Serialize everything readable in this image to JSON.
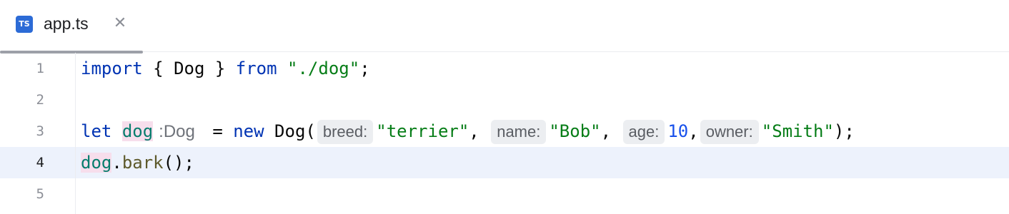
{
  "tab": {
    "icon_text": "TS",
    "file_name": "app.ts",
    "close_glyph": "✕"
  },
  "gutter": {
    "line_numbers": [
      "1",
      "2",
      "3",
      "4",
      "5"
    ],
    "current_line": 4
  },
  "code": {
    "line1": {
      "kw_import": "import",
      "brace_open": " { ",
      "ident": "Dog",
      "brace_close": " } ",
      "kw_from": "from",
      "space": " ",
      "module": "\"./dog\"",
      "semi": ";"
    },
    "line3": {
      "kw_let": "let",
      "space1": " ",
      "var": "dog",
      "type_hint": ":Dog",
      "eq": " = ",
      "kw_new": "new",
      "space2": " ",
      "ctor": "Dog",
      "paren_open": "(",
      "hint_breed": "breed:",
      "val_breed": "\"terrier\"",
      "comma1": ", ",
      "hint_name": "name:",
      "val_name": "\"Bob\"",
      "comma2": ", ",
      "hint_age": "age:",
      "val_age": "10",
      "comma3": ",",
      "hint_owner": "owner:",
      "val_owner": "\"Smith\"",
      "close": ");"
    },
    "line4": {
      "var": "dog",
      "dot": ".",
      "method": "bark",
      "close": "();"
    }
  },
  "colors": {
    "keyword": "#0033b3",
    "string": "#067d17",
    "number": "#1750eb",
    "variable": "#067d6d",
    "current_line": "#edf2fc",
    "ts_icon": "#2c6bd6"
  },
  "icons": {
    "file_type": "typescript-file-icon",
    "close": "close-icon"
  }
}
